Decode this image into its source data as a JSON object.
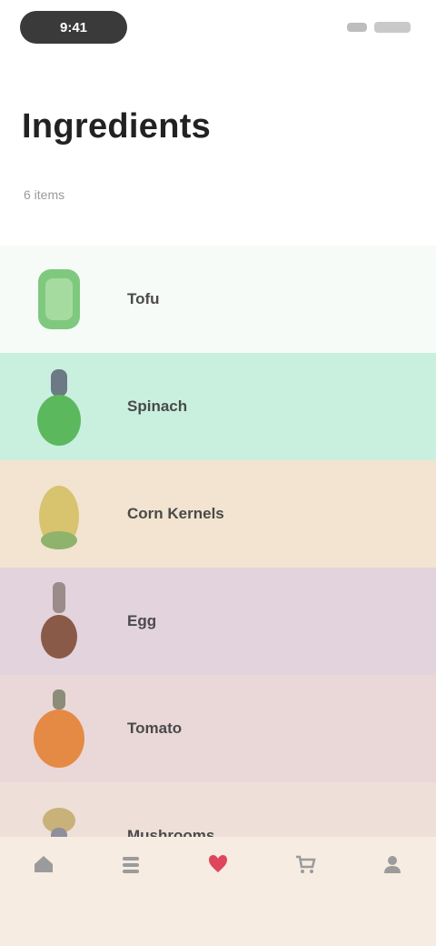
{
  "status_bar": {
    "time": "9:41"
  },
  "header": {
    "title": "Ingredients",
    "subtitle": "6 items"
  },
  "rows": [
    {
      "label": "Tofu",
      "sub": "",
      "bg": "#f7fbf8",
      "icon": "tofu-icon"
    },
    {
      "label": "Spinach",
      "sub": "",
      "bg": "#c9efdf",
      "icon": "spinach-icon"
    },
    {
      "label": "Corn Kernels",
      "sub": "",
      "bg": "#f2e4d0",
      "icon": "corn-icon"
    },
    {
      "label": "Egg",
      "sub": "",
      "bg": "#e3d3dc",
      "icon": "egg-icon"
    },
    {
      "label": "Tomato",
      "sub": "",
      "bg": "#ead8d8",
      "icon": "tomato-icon"
    },
    {
      "label": "Mushrooms",
      "sub": "",
      "bg": "#eedfd8",
      "icon": "mushroom-icon"
    }
  ],
  "tabbar": {
    "tabs": [
      {
        "label": "",
        "icon": "home-icon"
      },
      {
        "label": "",
        "icon": "list-icon"
      },
      {
        "label": "",
        "icon": "heart-icon"
      },
      {
        "label": "",
        "icon": "cart-icon"
      },
      {
        "label": "",
        "icon": "profile-icon"
      }
    ],
    "active_color": "#e0455e"
  }
}
